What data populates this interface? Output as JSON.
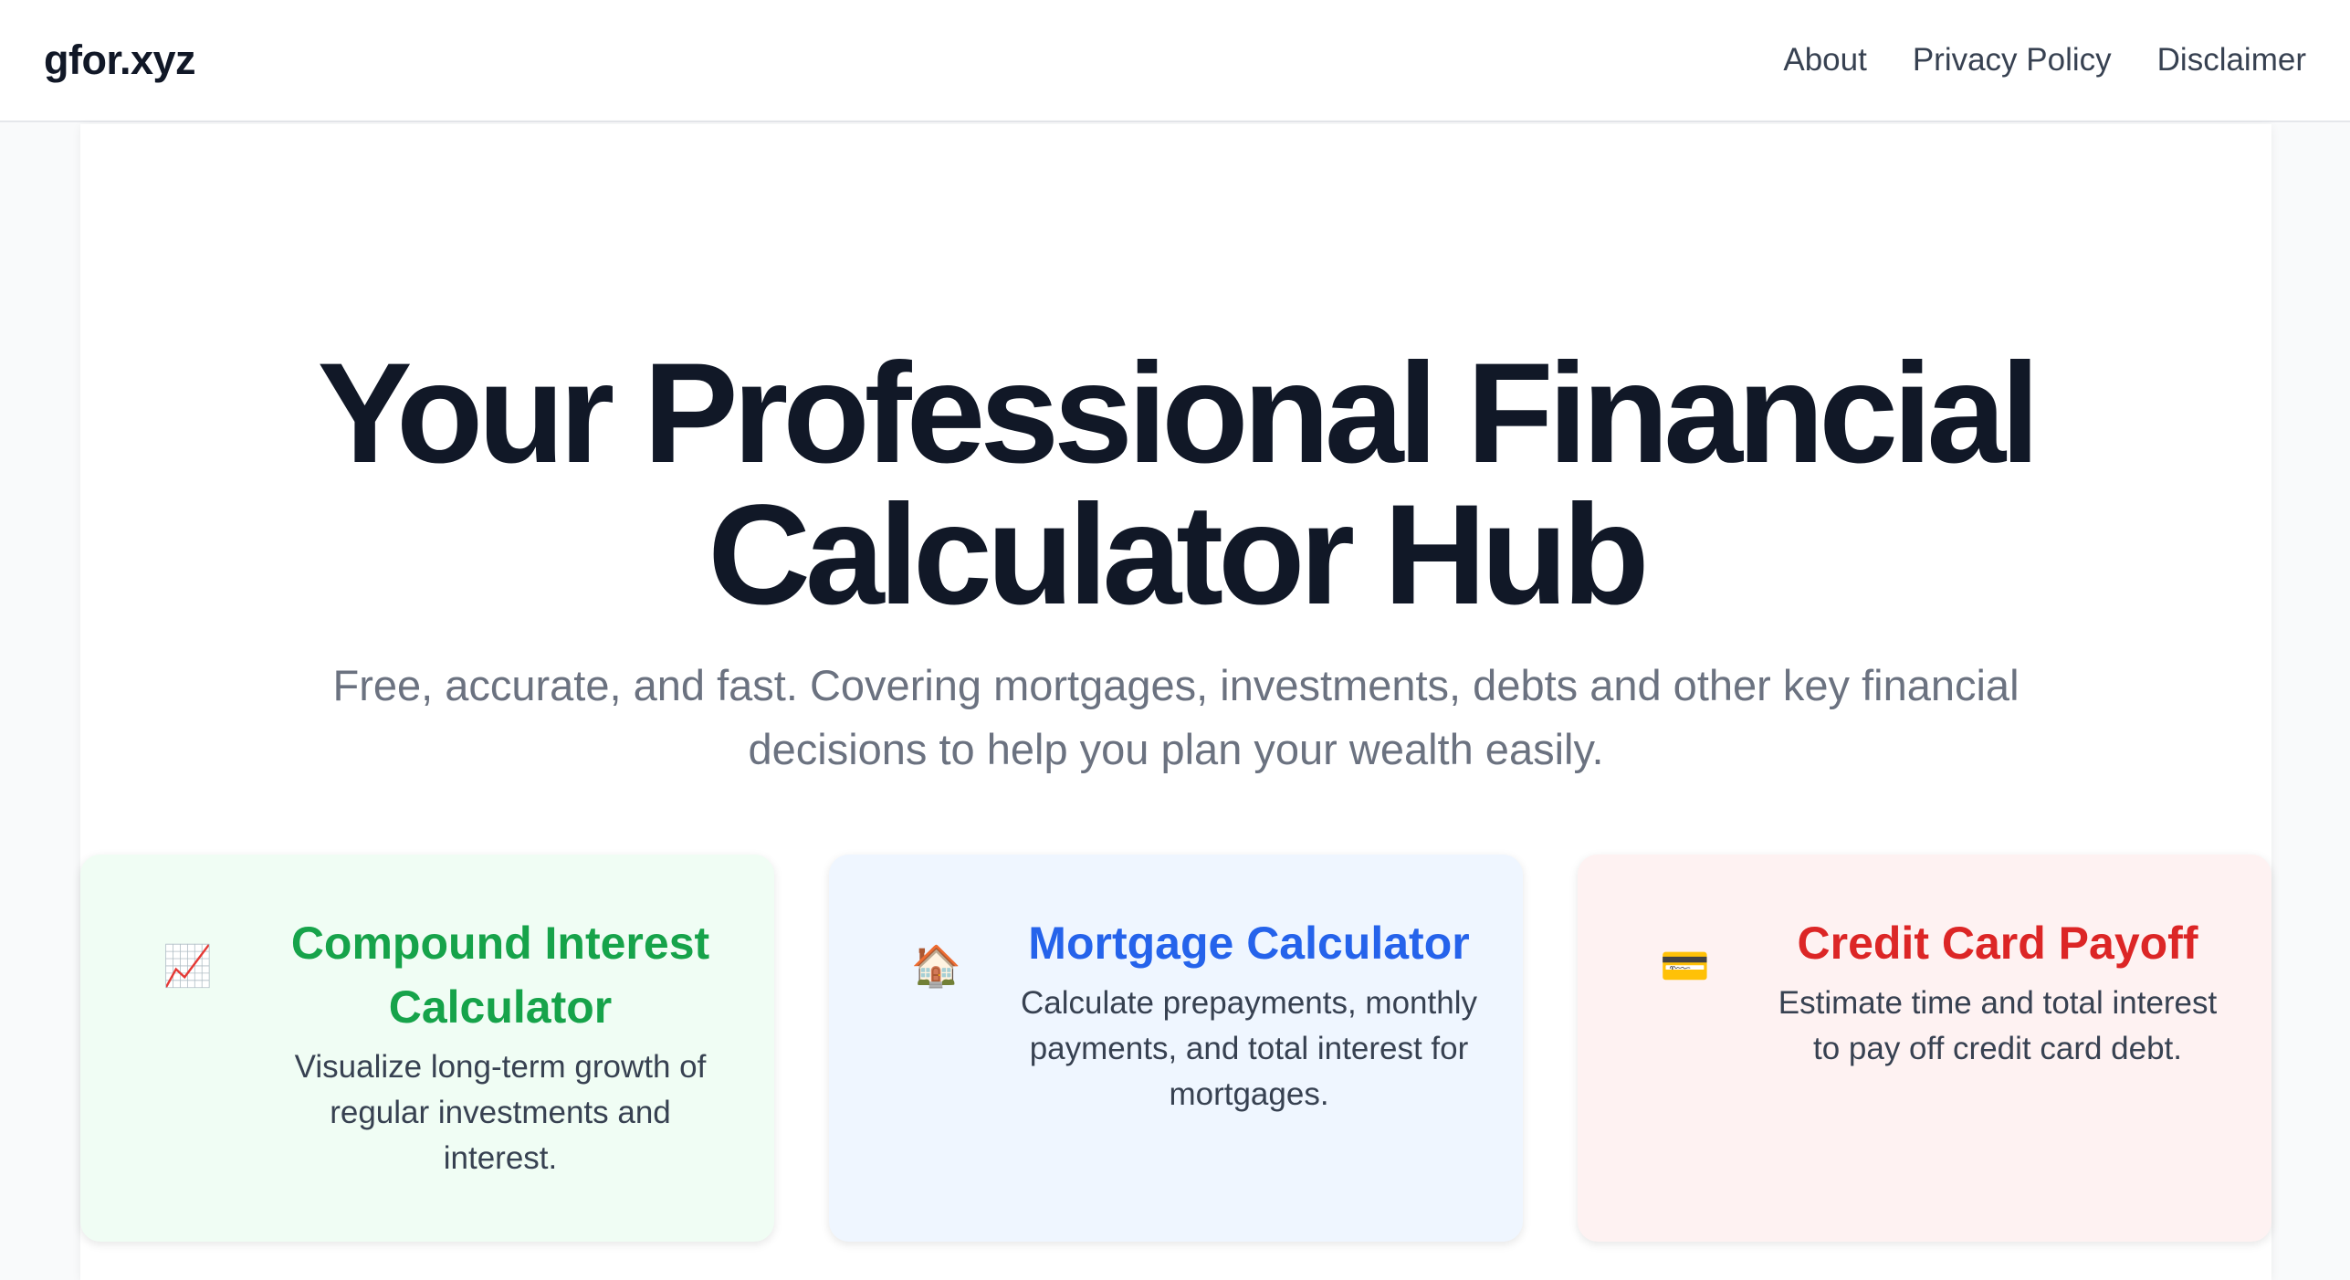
{
  "header": {
    "brand": "gfor.xyz",
    "nav": [
      {
        "label": "About"
      },
      {
        "label": "Privacy Policy"
      },
      {
        "label": "Disclaimer"
      }
    ]
  },
  "hero": {
    "title": "Your Professional Financial Calculator Hub",
    "subtitle": "Free, accurate, and fast. Covering mortgages, investments, debts and other key financial decisions to help you plan your wealth easily."
  },
  "cards": [
    {
      "icon": "chart-increasing-icon",
      "icon_glyph": "📈",
      "title": "Compound Interest Calculator",
      "description": "Visualize long-term growth of regular investments and interest.",
      "accent": "#16a34a",
      "background": "#f0fdf4"
    },
    {
      "icon": "house-icon",
      "icon_glyph": "🏠",
      "title": "Mortgage Calculator",
      "description": "Calculate prepayments, monthly payments, and total interest for mortgages.",
      "accent": "#2563eb",
      "background": "#eff6ff"
    },
    {
      "icon": "credit-card-icon",
      "icon_glyph": "💳",
      "title": "Credit Card Payoff",
      "description": "Estimate time and total interest to pay off credit card debt.",
      "accent": "#dc2626",
      "background": "#fef2f2"
    }
  ]
}
